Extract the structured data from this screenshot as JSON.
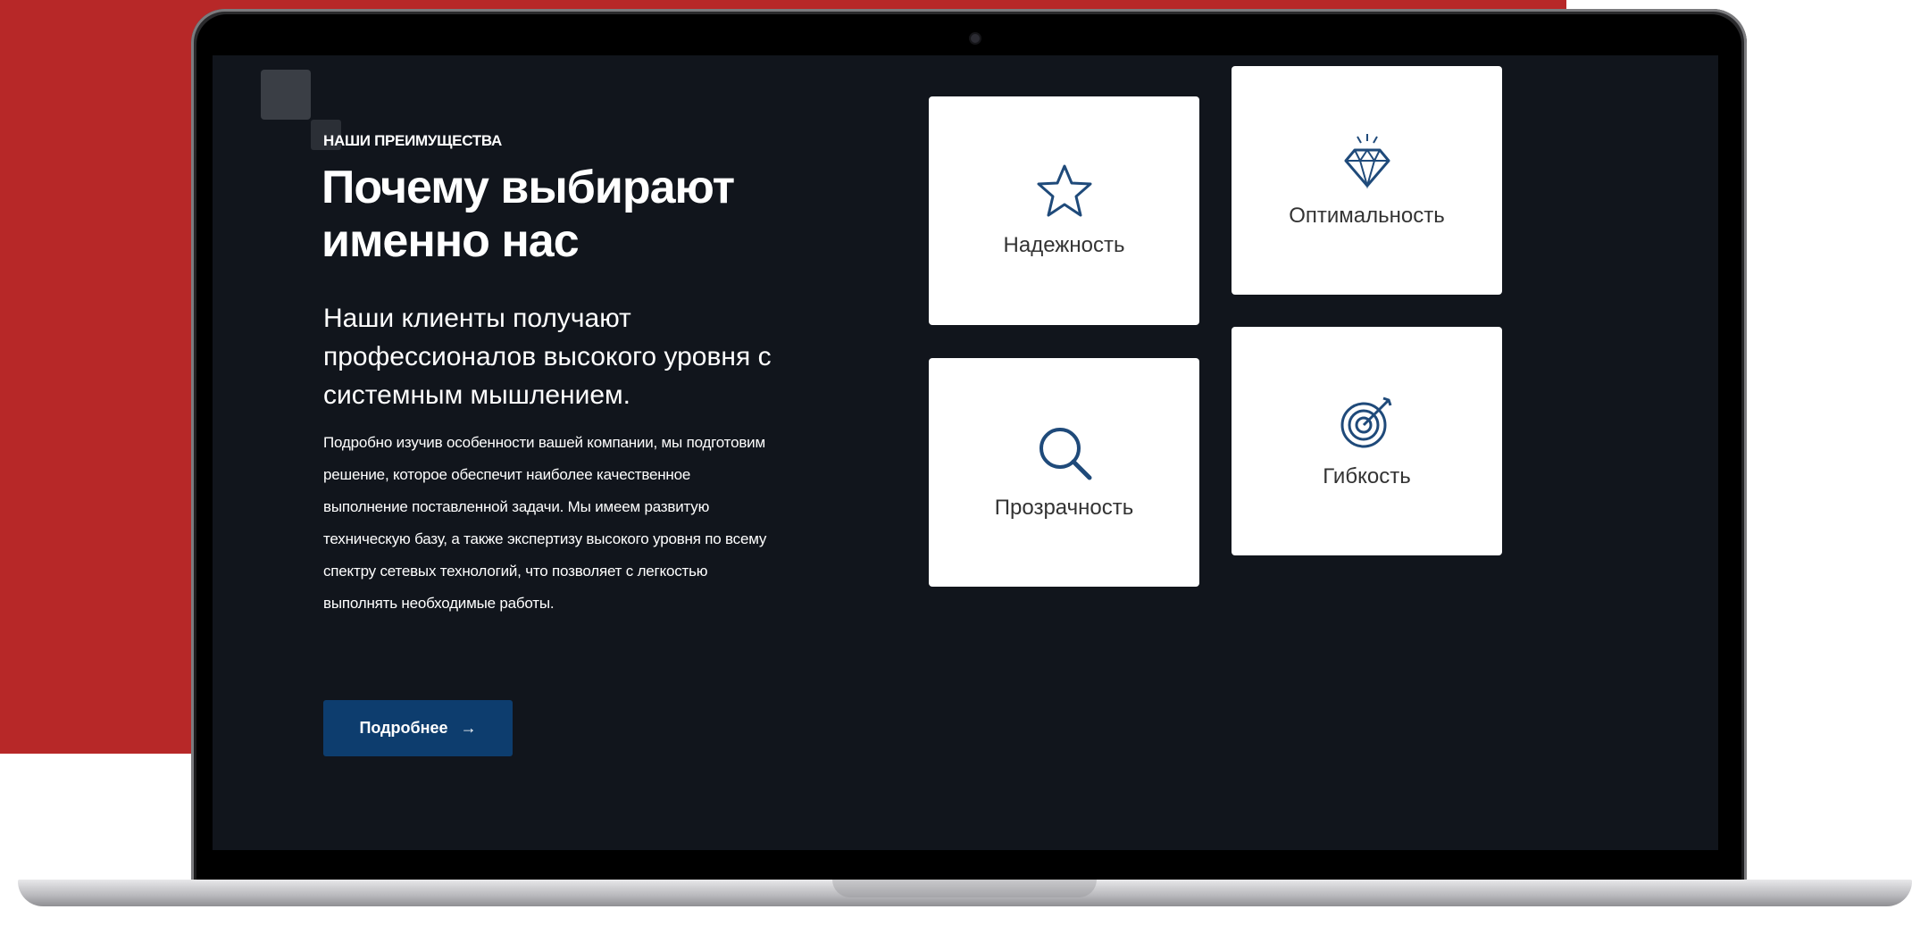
{
  "section": {
    "eyebrow": "НАШИ ПРЕИМУЩЕСТВА",
    "title": "Почему выбирают именно нас",
    "lead": "Наши клиенты получают профессионалов высокого уровня с системным мышлением.",
    "body": "Подробно изучив особенности вашей компании, мы подготовим решение, которое обеспечит наиболее качественное выполнение поставленной задачи. Мы имеем развитую техническую базу, а также экспертизу высокого уровня по всему спектру сетевых технологий, что позволяет с легкостью выполнять необходимые работы.",
    "button_label": "Подробнее",
    "button_arrow": "→"
  },
  "cards": [
    {
      "label": "Надежность",
      "icon": "star-icon"
    },
    {
      "label": "Оптимальность",
      "icon": "diamond-icon"
    },
    {
      "label": "Прозрачность",
      "icon": "magnifier-icon"
    },
    {
      "label": "Гибкость",
      "icon": "target-icon"
    }
  ],
  "colors": {
    "background_accent": "#b72828",
    "screen_background": "#11151c",
    "button": "#0d3d6e",
    "icon_stroke": "#1f4a7a"
  }
}
